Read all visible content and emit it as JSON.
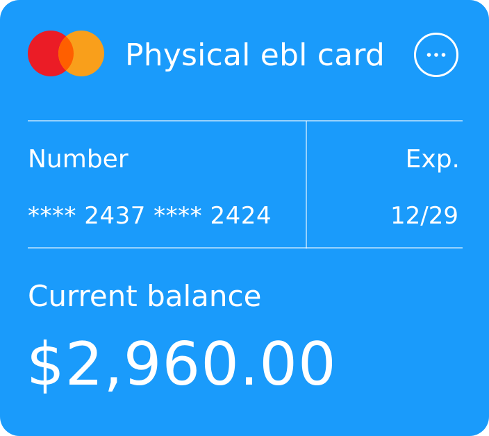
{
  "card": {
    "brand_icon": "mastercard-logo-icon",
    "title": "Physical ebl card",
    "more_icon": "more-horizontal-icon",
    "colors": {
      "background": "#1a9bfb",
      "logo_red": "#eb1c26",
      "logo_orange": "#f99f1b",
      "logo_overlap": "#ff5f00"
    }
  },
  "details": {
    "number_label": "Number",
    "number_value": "**** 2437 **** 2424",
    "exp_label": "Exp.",
    "exp_value": "12/29"
  },
  "balance": {
    "label": "Current balance",
    "value": "$2,960.00"
  }
}
